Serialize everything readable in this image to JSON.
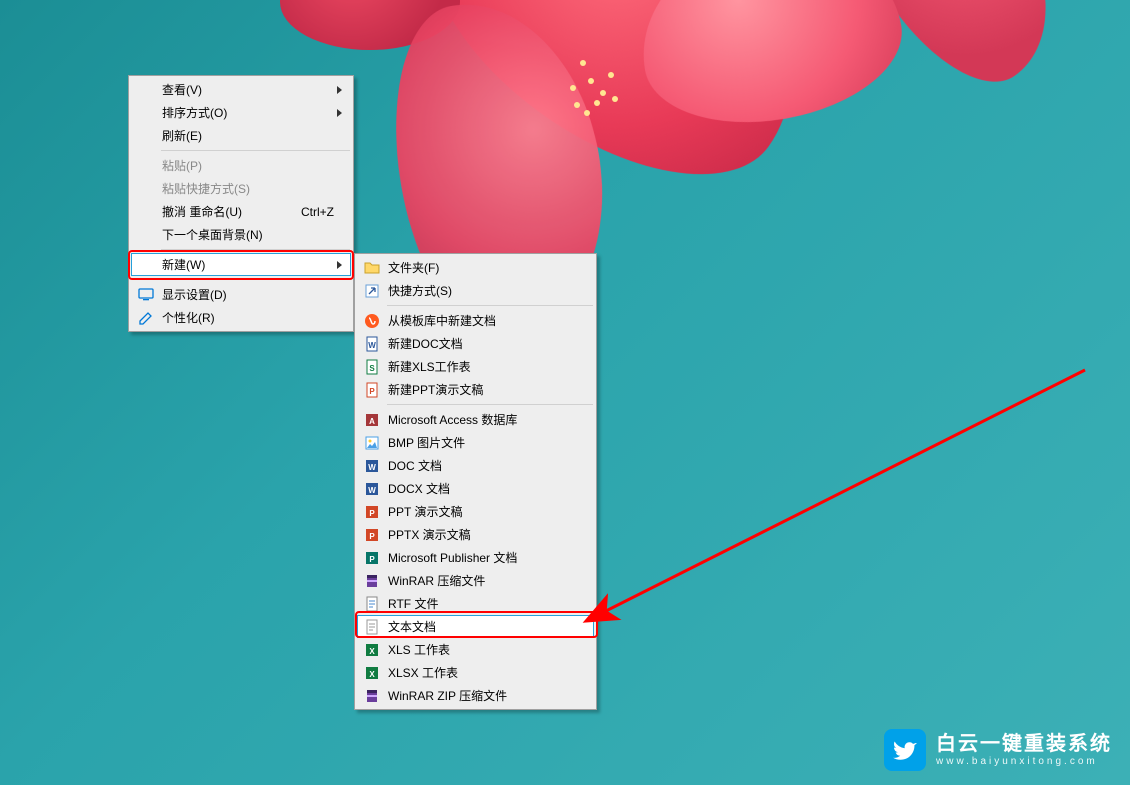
{
  "contextMenu": {
    "view": {
      "label": "查看(V)"
    },
    "sort": {
      "label": "排序方式(O)"
    },
    "refresh": {
      "label": "刷新(E)"
    },
    "paste": {
      "label": "粘贴(P)"
    },
    "pasteShortcut": {
      "label": "粘贴快捷方式(S)"
    },
    "undoRename": {
      "label": "撤消 重命名(U)",
      "shortcut": "Ctrl+Z"
    },
    "nextBg": {
      "label": "下一个桌面背景(N)"
    },
    "new": {
      "label": "新建(W)"
    },
    "display": {
      "label": "显示设置(D)"
    },
    "personalize": {
      "label": "个性化(R)"
    }
  },
  "newSubmenu": {
    "folder": {
      "label": "文件夹(F)"
    },
    "shortcut": {
      "label": "快捷方式(S)"
    },
    "template": {
      "label": "从模板库中新建文档"
    },
    "newDoc": {
      "label": "新建DOC文档"
    },
    "newXls": {
      "label": "新建XLS工作表"
    },
    "newPpt": {
      "label": "新建PPT演示文稿"
    },
    "accessDb": {
      "label": "Microsoft Access 数据库"
    },
    "bmp": {
      "label": "BMP 图片文件"
    },
    "docOld": {
      "label": "DOC 文档"
    },
    "docx": {
      "label": "DOCX 文档"
    },
    "ppt": {
      "label": "PPT 演示文稿"
    },
    "pptx": {
      "label": "PPTX 演示文稿"
    },
    "publisher": {
      "label": "Microsoft Publisher 文档"
    },
    "winrar": {
      "label": "WinRAR 压缩文件"
    },
    "rtf": {
      "label": "RTF 文件"
    },
    "txt": {
      "label": "文本文档"
    },
    "xls": {
      "label": "XLS 工作表"
    },
    "xlsx": {
      "label": "XLSX 工作表"
    },
    "winrarZip": {
      "label": "WinRAR ZIP 压缩文件"
    }
  },
  "watermark": {
    "title": "白云一键重装系统",
    "url": "www.baiyunxitong.com"
  }
}
